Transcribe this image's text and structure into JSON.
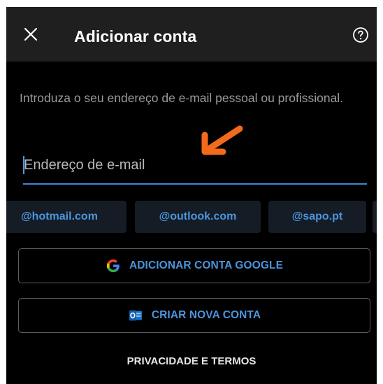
{
  "header": {
    "title": "Adicionar conta",
    "close_icon": "close-icon",
    "help_icon": "help-icon"
  },
  "form": {
    "instruction": "Introduza o seu endereço de e-mail pessoal ou profissional.",
    "email": {
      "value": "",
      "placeholder": "Endereço de e-mail"
    }
  },
  "domain_suggestions": [
    "@hotmail.com",
    "@outlook.com",
    "@sapo.pt"
  ],
  "actions": {
    "google_label": "ADICIONAR CONTA GOOGLE",
    "google_icon": "google-icon",
    "create_label": "CRIAR NOVA CONTA",
    "create_icon": "outlook-icon"
  },
  "footer": {
    "privacy_label": "PRIVACIDADE E TERMOS"
  },
  "colors": {
    "background": "#000000",
    "appbar": "#1f1f1f",
    "accent": "#4b95dd",
    "annotation_arrow": "#f26a1b"
  }
}
